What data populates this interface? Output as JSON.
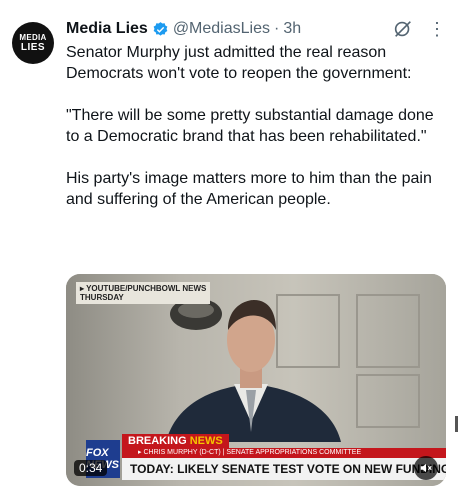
{
  "account": {
    "avatar_line1": "MEDIA",
    "avatar_line2": "LIES",
    "name": "Media Lies",
    "handle": "@MediasLies",
    "separator": "·",
    "time": "3h"
  },
  "tweet": {
    "paragraphs": [
      "Senator Murphy just admitted the real reason Democrats won't vote to reopen the government:",
      "\"There will be some pretty substantial damage done to a Democratic brand that has been rehabilitated.\"",
      "His party's image matters more to him than the pain and suffering of the American people."
    ]
  },
  "video": {
    "source_line1": "▸ YOUTUBE/PUNCHBOWL NEWS",
    "source_line2": "THURSDAY",
    "breaking": "BREAKING",
    "breaking_news": "NEWS",
    "lower_third_1": "▸ CHRIS MURPHY (D-CT) | SENATE APPROPRIATIONS COMMITTEE",
    "lower_third_2": "TODAY: LIKELY SENATE TEST VOTE ON NEW FUNDING PLAN",
    "network_logo": "FOX NEWS",
    "duration": "0:34"
  },
  "icons": {
    "verified": "verified-badge-icon",
    "grok": "grok-icon",
    "more": "more-icon",
    "mute": "speaker-muted-icon"
  },
  "colors": {
    "verified": "#1d9bf0",
    "text": "#0f1419",
    "muted_text": "#536471",
    "breaking_red": "#c4161c"
  }
}
